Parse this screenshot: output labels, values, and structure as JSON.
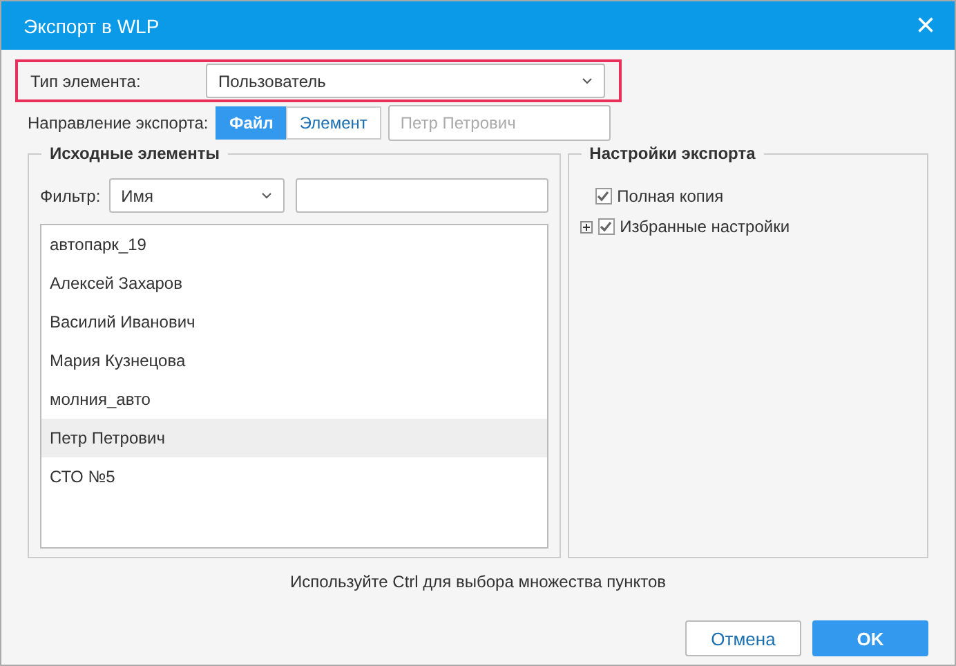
{
  "window": {
    "title": "Экспорт в WLP",
    "close": "×"
  },
  "element_type": {
    "label": "Тип элемента:",
    "value": "Пользователь",
    "highlighted": true
  },
  "direction": {
    "label": "Направление экспорта:",
    "options": [
      {
        "label": "Файл",
        "selected": true
      },
      {
        "label": "Элемент",
        "selected": false
      }
    ],
    "target_placeholder": "Петр Петрович"
  },
  "source": {
    "title": "Исходные элементы",
    "filter_label": "Фильтр:",
    "filter_value": "Имя",
    "items": [
      {
        "label": "автопарк_19",
        "selected": false
      },
      {
        "label": "Алексей Захаров",
        "selected": false
      },
      {
        "label": "Василий Иванович",
        "selected": false
      },
      {
        "label": "Мария Кузнецова",
        "selected": false
      },
      {
        "label": "молния_авто",
        "selected": false
      },
      {
        "label": "Петр Петрович",
        "selected": true
      },
      {
        "label": "СТО №5",
        "selected": false
      }
    ]
  },
  "settings": {
    "title": "Настройки экспорта",
    "items": [
      {
        "label": "Полная копия",
        "checked": true,
        "expandable": false
      },
      {
        "label": "Избранные настройки",
        "checked": true,
        "expandable": true,
        "expanded": false
      }
    ]
  },
  "hint": "Используйте Ctrl для выбора множества пунктов",
  "buttons": [
    {
      "label": "Отмена",
      "kind": "secondary"
    },
    {
      "label": "OK",
      "kind": "primary"
    }
  ]
}
